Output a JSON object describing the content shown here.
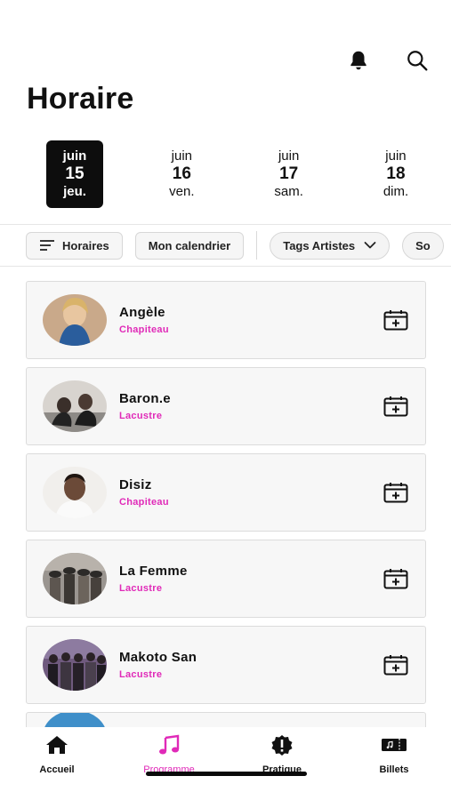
{
  "header": {
    "title": "Horaire",
    "icons": [
      "bell-icon",
      "search-icon"
    ]
  },
  "dates": [
    {
      "month": "juin",
      "day": "15",
      "weekday": "jeu.",
      "selected": true
    },
    {
      "month": "juin",
      "day": "16",
      "weekday": "ven.",
      "selected": false
    },
    {
      "month": "juin",
      "day": "17",
      "weekday": "sam.",
      "selected": false
    },
    {
      "month": "juin",
      "day": "18",
      "weekday": "dim.",
      "selected": false
    }
  ],
  "filters": {
    "horaires": "Horaires",
    "calendar": "Mon calendrier",
    "tags": "Tags Artistes",
    "partial": "So"
  },
  "artists": [
    {
      "name": "Angèle",
      "stage": "Chapiteau"
    },
    {
      "name": "Baron.e",
      "stage": "Lacustre"
    },
    {
      "name": "Disiz",
      "stage": "Chapiteau"
    },
    {
      "name": "La Femme",
      "stage": "Lacustre"
    },
    {
      "name": "Makoto San",
      "stage": "Lacustre"
    }
  ],
  "tabbar": {
    "items": [
      {
        "label": "Accueil",
        "icon": "home-icon",
        "active": false
      },
      {
        "label": "Programme",
        "icon": "music-note-icon",
        "active": true
      },
      {
        "label": "Pratique",
        "icon": "info-badge-icon",
        "active": false
      },
      {
        "label": "Billets",
        "icon": "ticket-icon",
        "active": false
      }
    ]
  },
  "colors": {
    "accent": "#e02ab8",
    "selected_date_bg": "#0d0d0d",
    "card_bg": "#f7f7f7"
  }
}
